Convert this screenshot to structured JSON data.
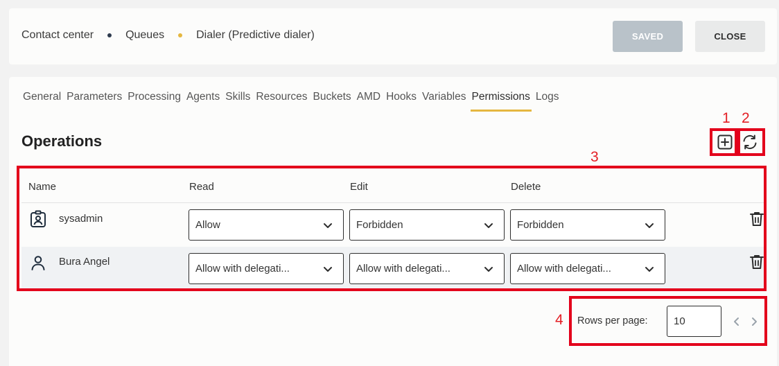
{
  "breadcrumb": {
    "items": [
      "Contact center",
      "Queues",
      "Dialer (Predictive dialer)"
    ],
    "dot_colors": [
      "#2e3b4e",
      "#e5b740"
    ]
  },
  "header": {
    "saved_label": "SAVED",
    "close_label": "CLOSE"
  },
  "tabs": [
    "General",
    "Parameters",
    "Processing",
    "Agents",
    "Skills",
    "Resources",
    "Buckets",
    "AMD",
    "Hooks",
    "Variables",
    "Permissions",
    "Logs"
  ],
  "active_tab": "Permissions",
  "section": {
    "title": "Operations"
  },
  "markers": [
    "1",
    "2",
    "3",
    "4"
  ],
  "table": {
    "columns": [
      "Name",
      "Read",
      "Edit",
      "Delete"
    ],
    "rows": [
      {
        "icon": "id-badge-icon",
        "name": "sysadmin",
        "read": "Allow",
        "edit": "Forbidden",
        "delete": "Forbidden"
      },
      {
        "icon": "user-icon",
        "name": "Bura Angel",
        "read": "Allow with delegati...",
        "edit": "Allow with delegati...",
        "delete": "Allow with delegati..."
      }
    ]
  },
  "pagination": {
    "rows_per_page_label": "Rows per page:",
    "rows_per_page_value": "10"
  },
  "colors": {
    "accent": "#e5b740",
    "annotation": "#e3001b",
    "saved_button": "#b9c2c9"
  }
}
